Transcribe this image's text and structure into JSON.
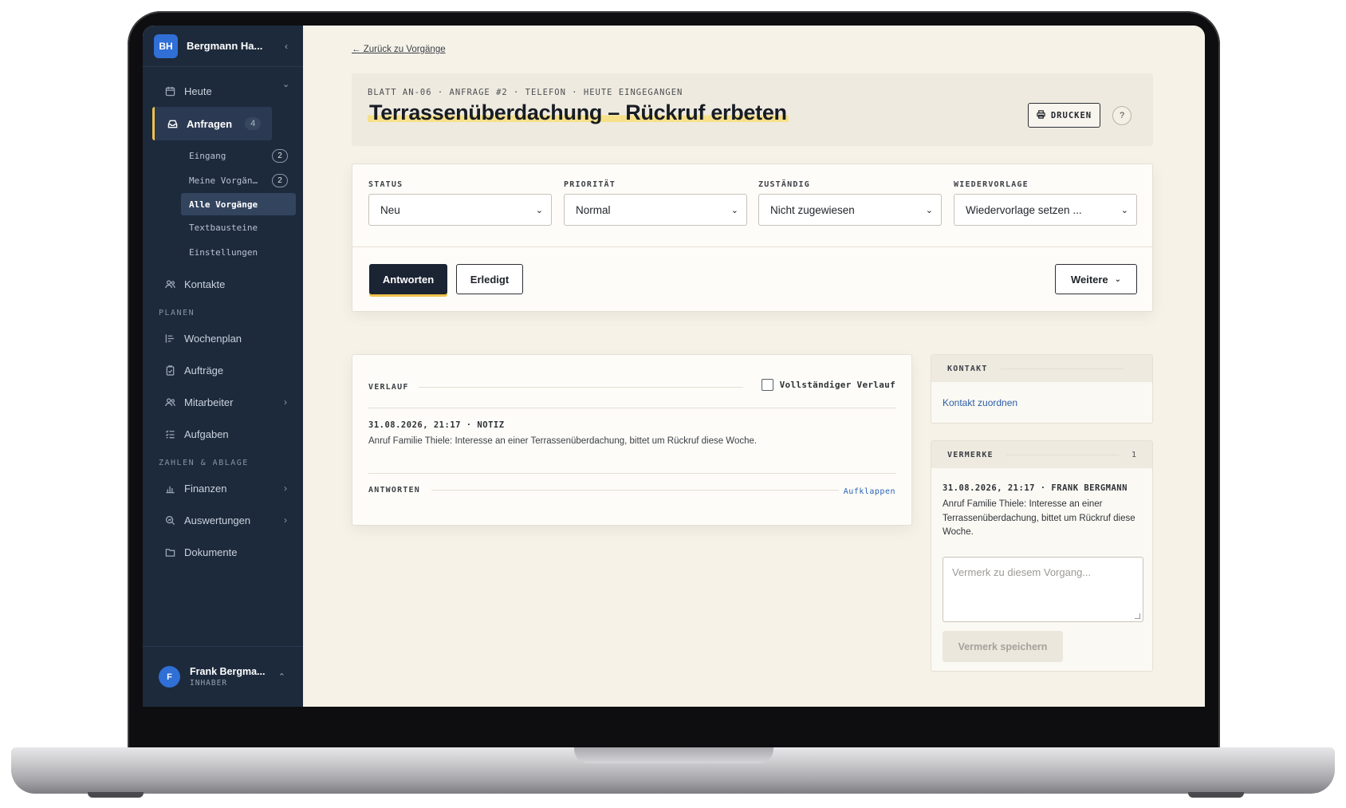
{
  "sidebar": {
    "org_initials": "BH",
    "org_name": "Bergmann Ha...",
    "items": {
      "heute": "Heute",
      "anfragen": "Anfragen",
      "anfragen_count": "4",
      "kontakte": "Kontakte",
      "wochenplan": "Wochenplan",
      "auftraege": "Aufträge",
      "mitarbeiter": "Mitarbeiter",
      "aufgaben": "Aufgaben",
      "finanzen": "Finanzen",
      "auswertungen": "Auswertungen",
      "dokumente": "Dokumente"
    },
    "sub_items": {
      "eingang": "Eingang",
      "eingang_count": "2",
      "meine": "Meine Vorgän…",
      "meine_count": "2",
      "alle": "Alle Vorgänge",
      "textbausteine": "Textbausteine",
      "einstellungen": "Einstellungen"
    },
    "sections": {
      "planen": "PLANEN",
      "zahlen": "ZAHLEN & ABLAGE"
    },
    "user": {
      "initial": "F",
      "name": "Frank Bergma...",
      "role": "INHABER"
    }
  },
  "main": {
    "back_link": "← Zurück zu Vorgänge",
    "breadcrumb": "BLATT AN-06 · ANFRAGE #2 · TELEFON · HEUTE EINGEGANGEN",
    "title": "Terrassenüberdachung – Rückruf erbeten",
    "print_label": "DRUCKEN",
    "help_label": "?",
    "fields": {
      "status_label": "STATUS",
      "status_value": "Neu",
      "prioritaet_label": "PRIORITÄT",
      "prioritaet_value": "Normal",
      "zustaendig_label": "ZUSTÄNDIG",
      "zustaendig_value": "Nicht zugewiesen",
      "wiedervorlage_label": "WIEDERVORLAGE",
      "wiedervorlage_value": "Wiedervorlage setzen ..."
    },
    "actions": {
      "antworten": "Antworten",
      "erledigt": "Erledigt",
      "weitere": "Weitere"
    },
    "verlauf": {
      "label": "VERLAUF",
      "checkbox_label": "Vollständiger Verlauf",
      "entry_meta": "31.08.2026, 21:17 · NOTIZ",
      "entry_text": "Anruf Familie Thiele: Interesse an einer Terrassenüberdachung, bittet um Rückruf diese Woche.",
      "antworten_label": "ANTWORTEN",
      "expand_link": "Aufklappen"
    },
    "kontakt": {
      "label": "KONTAKT",
      "link": "Kontakt zuordnen"
    },
    "vermerke": {
      "label": "VERMERKE",
      "count": "1",
      "note_meta": "31.08.2026, 21:17 · FRANK BERGMANN",
      "note_text": "Anruf Familie Thiele: Interesse an einer Terrassenüberdachung, bittet um Rückruf diese Woche.",
      "input_placeholder": "Vermerk zu diesem Vorgang...",
      "save_label": "Vermerk speichern"
    }
  },
  "colors": {
    "sidebar_bg": "#1d2a3c",
    "accent_yellow": "#f0c24a",
    "brand_blue": "#2f6fd6",
    "page_bg": "#f6f2e8",
    "link_blue": "#2a5ea8"
  }
}
